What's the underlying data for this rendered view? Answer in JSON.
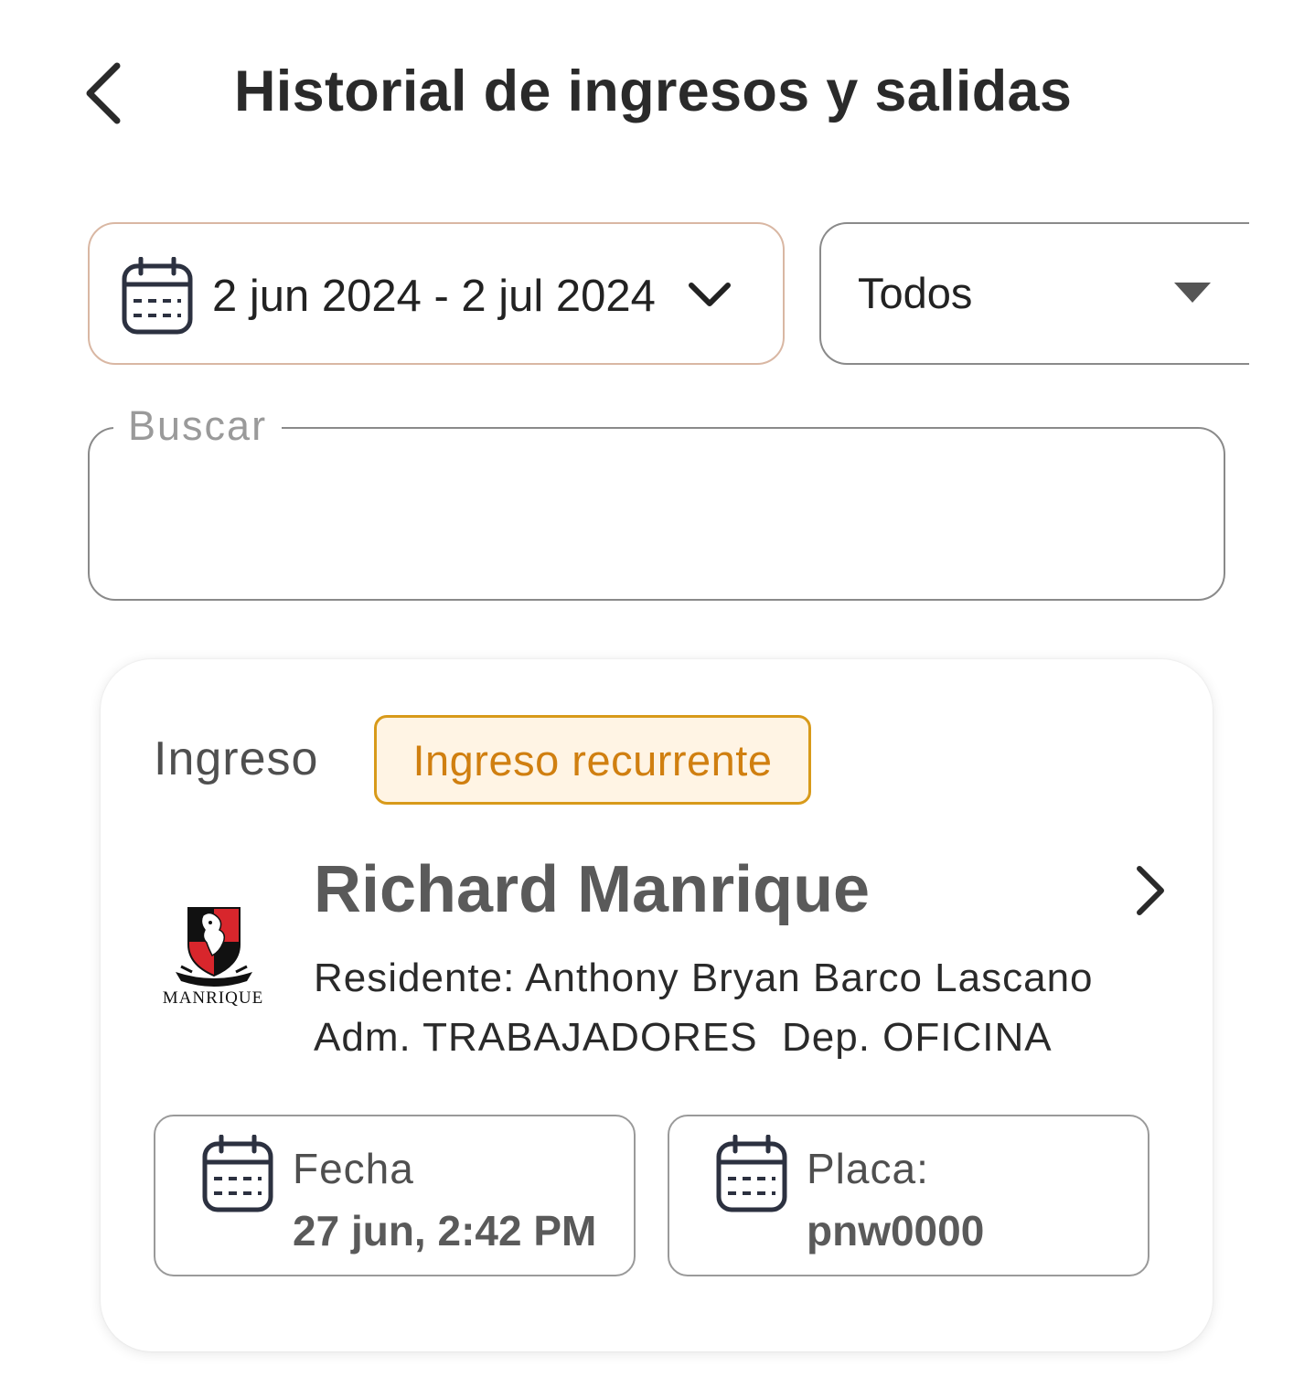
{
  "header": {
    "title": "Historial de ingresos y salidas",
    "back_icon": "chevron-left-icon"
  },
  "filters": {
    "date_range": "2 jun 2024 - 2 jul 2024",
    "date_icon": "calendar-icon",
    "type_select_value": "Todos",
    "search_label": "Buscar",
    "search_value": ""
  },
  "records": [
    {
      "type": "Ingreso",
      "badge": "Ingreso recurrente",
      "name": "Richard Manrique",
      "logo_text": "MANRIQUE",
      "resident": "Residente: Anthony Bryan Barco Lascano",
      "adm": "Adm. TRABAJADORES",
      "dep": "Dep. OFICINA",
      "date_label": "Fecha",
      "date_value": "27 jun, 2:42 PM",
      "plate_label": "Placa:",
      "plate_value": "pnw0000"
    }
  ],
  "colors": {
    "badge_text": "#d07f10",
    "badge_border": "#d89a1a",
    "badge_bg": "#fff4e4",
    "date_border": "#d9b7a3"
  }
}
